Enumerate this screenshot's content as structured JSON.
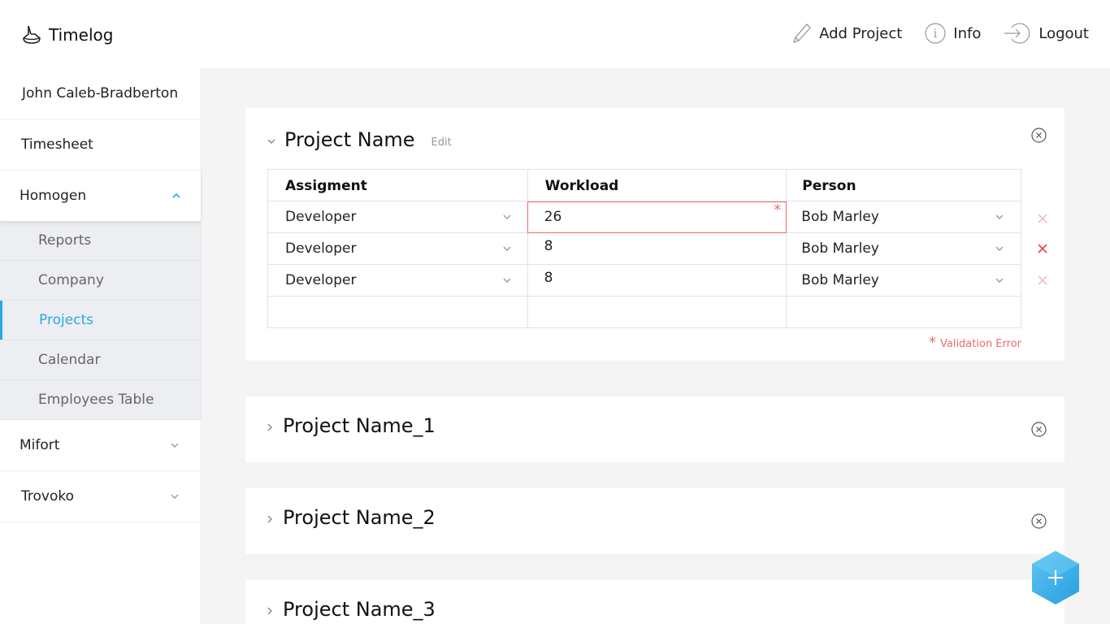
{
  "app": {
    "title": "Timelog"
  },
  "topnav": {
    "add_project": "Add Project",
    "info": "Info",
    "logout": "Logout"
  },
  "sidebar": {
    "user": "John Caleb-Bradberton",
    "timesheet": "Timesheet",
    "groups": [
      {
        "label": "Homogen",
        "expanded": true,
        "items": [
          "Reports",
          "Company",
          "Projects",
          "Calendar",
          "Employees Table"
        ],
        "active": "Projects"
      },
      {
        "label": "Mifort",
        "expanded": false
      },
      {
        "label": "Trovoko",
        "expanded": false
      }
    ]
  },
  "projects": [
    {
      "title": "Project Name",
      "edit_label": "Edit",
      "expanded": true,
      "columns": [
        "Assigment",
        "Workload",
        "Person"
      ],
      "rows": [
        {
          "assignment": "Developer",
          "workload": "26",
          "person": "Bob Marley",
          "error": true
        },
        {
          "assignment": "Developer",
          "workload": "8",
          "person": "Bob Marley"
        },
        {
          "assignment": "Developer",
          "workload": "8",
          "person": "Bob Marley"
        }
      ],
      "required_mark": "*",
      "validation_error": "Validation Error"
    },
    {
      "title": "Project Name_1",
      "expanded": false
    },
    {
      "title": "Project Name_2",
      "expanded": false
    },
    {
      "title": "Project Name_3",
      "expanded": false
    }
  ],
  "colors": {
    "accent": "#2aa7e6",
    "error": "#ee6b6b",
    "fab": "#3fb0ea"
  },
  "icons": [
    "logo-icon",
    "pencil-icon",
    "info-icon",
    "logout-icon",
    "chevron-up-icon",
    "chevron-down-icon",
    "chevron-right-icon",
    "close-circle-icon",
    "delete-x-icon",
    "plus-icon"
  ]
}
